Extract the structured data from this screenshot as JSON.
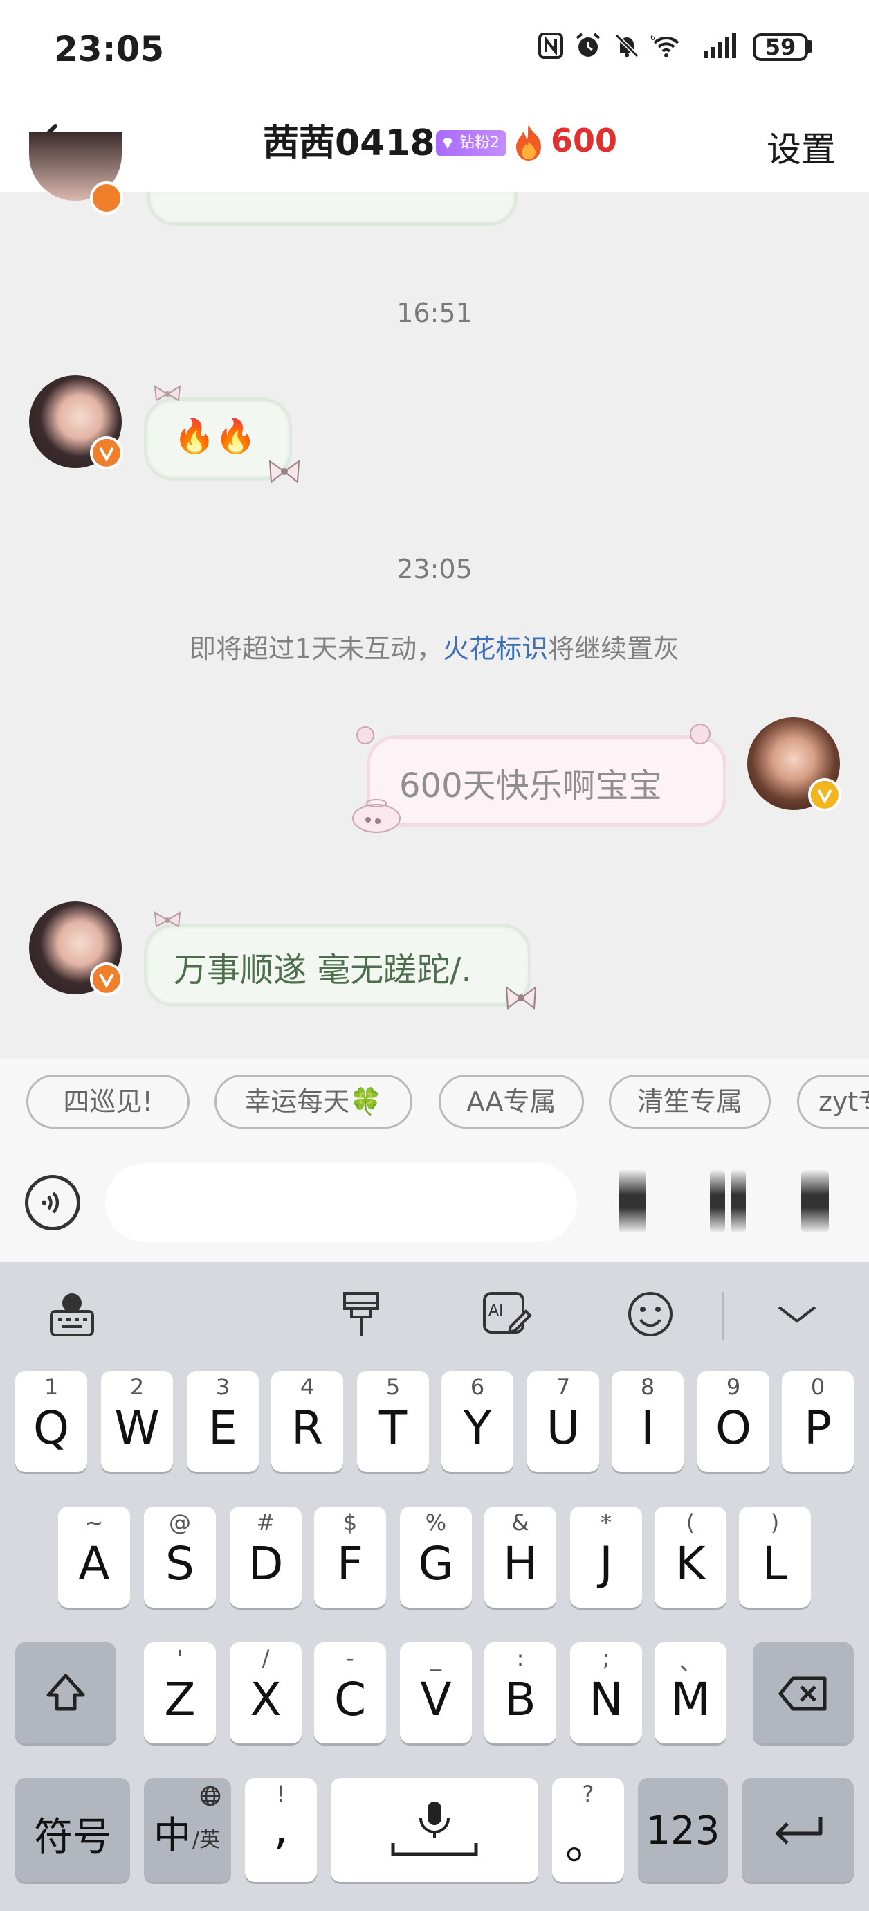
{
  "status_bar": {
    "time": "23:05",
    "battery": "59",
    "icons": [
      "nfc-icon",
      "alarm-icon",
      "mute-icon",
      "wifi-icon",
      "signal-icon",
      "battery-icon"
    ]
  },
  "header": {
    "title": "茜茜0418",
    "fan_badge": "钻粉2",
    "spark_count": "600",
    "settings_label": "设置",
    "colors": {
      "spark": "#e0312e",
      "badge": "#b57dff"
    }
  },
  "chat": {
    "timestamp_1": "16:51",
    "msg_1": "🔥🔥",
    "timestamp_2": "23:05",
    "notice_before": "即将超过1天未互动，",
    "notice_link": "火花标识",
    "notice_after": "将继续置灰",
    "msg_2": "600天快乐啊宝宝",
    "msg_3": "万事顺遂 毫无蹉跎/."
  },
  "quick_phrases": [
    "四巡见!",
    "幸运每天🍀",
    "AA专属",
    "清笙专属",
    "zyt专"
  ],
  "input": {
    "placeholder": "",
    "value": ""
  },
  "keyboard": {
    "row1": [
      [
        "1",
        "Q"
      ],
      [
        "2",
        "W"
      ],
      [
        "3",
        "E"
      ],
      [
        "4",
        "R"
      ],
      [
        "5",
        "T"
      ],
      [
        "6",
        "Y"
      ],
      [
        "7",
        "U"
      ],
      [
        "8",
        "I"
      ],
      [
        "9",
        "O"
      ],
      [
        "0",
        "P"
      ]
    ],
    "row2": [
      [
        "~",
        "A"
      ],
      [
        "@",
        "S"
      ],
      [
        "#",
        "D"
      ],
      [
        "$",
        "F"
      ],
      [
        "%",
        "G"
      ],
      [
        "&",
        "H"
      ],
      [
        "*",
        "J"
      ],
      [
        "(",
        "K"
      ],
      [
        ")",
        "L"
      ]
    ],
    "row3": [
      [
        "'",
        "Z"
      ],
      [
        "/",
        "X"
      ],
      [
        "-",
        "C"
      ],
      [
        "_",
        "V"
      ],
      [
        ":",
        "B"
      ],
      [
        ";",
        "N"
      ],
      [
        "、",
        "M"
      ]
    ],
    "symbols_label": "符号",
    "lang_label": "中",
    "lang_sub": "/英",
    "comma_hint": "!",
    "comma": ",",
    "period_hint": "?",
    "period": "。",
    "num_label": "123"
  }
}
